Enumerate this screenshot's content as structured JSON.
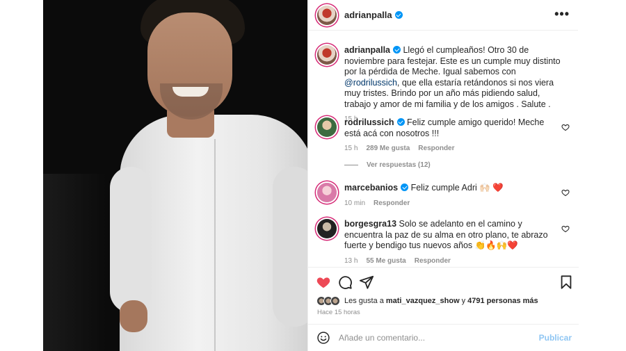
{
  "post": {
    "username": "adrianpalla",
    "menu_glyph": "•••",
    "caption": {
      "username": "adrianpalla",
      "text_before": " Llegó el cumpleaños! Otro 30 de noviembre para festejar. Este es un cumple muy distinto por la pérdida de Meche. Igual sabemos con ",
      "mention": "@rodrilussich",
      "text_after": ", que ella estaría retándonos si nos viera muy tristes. Brindo por un año más pidiendo salud, trabajo y amor de mi familia y de los amigos . Salute .",
      "time": "15 h"
    }
  },
  "comments": [
    {
      "username": "rodrilussich",
      "text": " Feliz cumple amigo querido! Meche está acá con nosotros !!!",
      "time": "15 h",
      "likes": "289 Me gusta",
      "reply": "Responder",
      "view_replies": "Ver respuestas (12)"
    },
    {
      "username": "marcebanios",
      "text": " Feliz cumple Adri 🙌🏻 ❤️",
      "time": "10 min",
      "reply": "Responder"
    },
    {
      "username": "borgesgra13",
      "text": " Solo se adelanto en el camino y encuentra la paz de su alma en otro plano, te abrazo fuerte y bendigo tus nuevos años 👏🔥🙌❤️",
      "time": "13 h",
      "likes": "55 Me gusta",
      "reply": "Responder"
    }
  ],
  "likes_line": {
    "prefix": "Les gusta a",
    "user": "mati_vazquez_show",
    "connector": "y",
    "others": "4791 personas más"
  },
  "posted_ago": "Hace 15 horas",
  "add_comment": {
    "placeholder": "Añade un comentario...",
    "post_label": "Publicar"
  },
  "colors": {
    "like_red": "#ed4956",
    "link_blue": "#00376b",
    "verified_blue": "#0095f6",
    "publish_disabled": "#8fc6f3"
  },
  "icons": [
    "verified-icon",
    "more-options-icon",
    "heart-icon",
    "comment-icon",
    "share-icon",
    "bookmark-icon",
    "emoji-icon"
  ]
}
